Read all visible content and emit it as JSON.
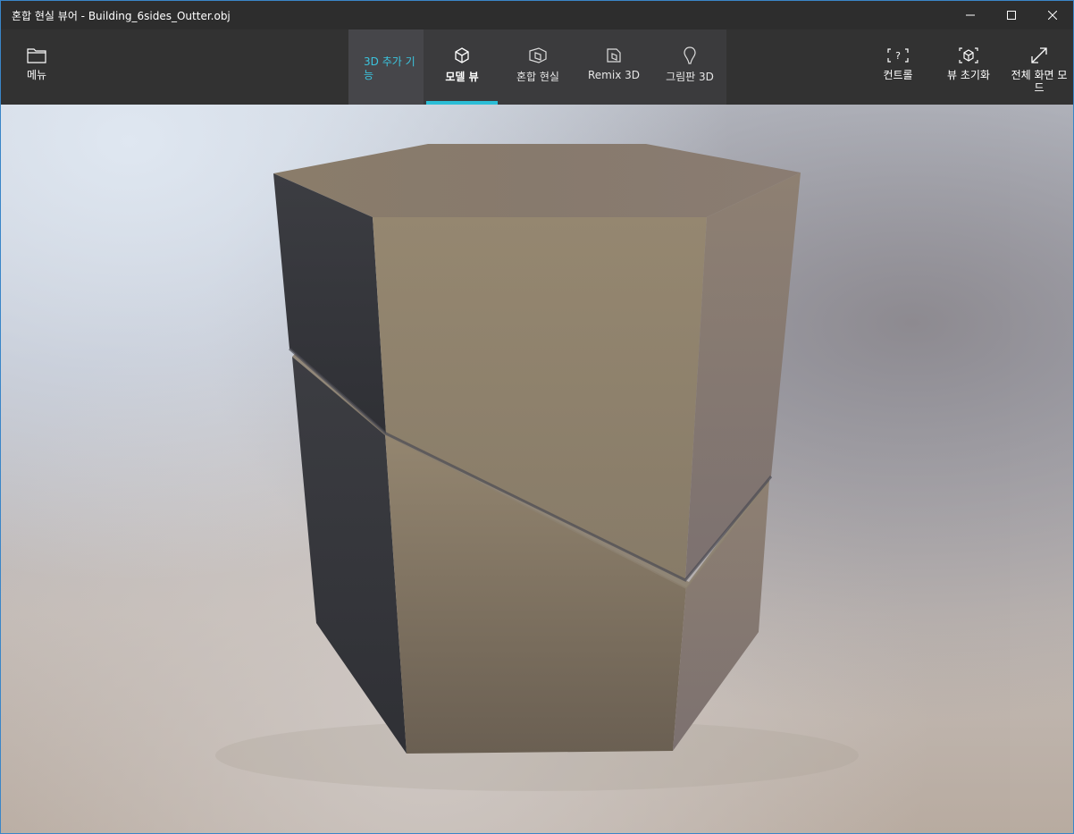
{
  "window": {
    "title": "혼합 현실 뷰어 - Building_6sides_Outter.obj",
    "buttons": {
      "minimize": "minimize-icon",
      "maximize": "maximize-icon",
      "close": "close-icon"
    }
  },
  "toolbar": {
    "menu_label": "메뉴",
    "addon_label": "3D 추가 기능",
    "tabs": [
      {
        "label": "모델 뷰",
        "icon": "cube-icon",
        "active": true
      },
      {
        "label": "혼합 현실",
        "icon": "mixed-reality-icon",
        "active": false
      },
      {
        "label": "Remix 3D",
        "icon": "remix-3d-icon",
        "active": false
      },
      {
        "label": "그림판 3D",
        "icon": "paint-3d-icon",
        "active": false
      }
    ],
    "right": [
      {
        "label": "컨트롤",
        "icon": "controls-help-icon"
      },
      {
        "label": "뷰 초기화",
        "icon": "reset-view-icon"
      },
      {
        "label": "전체 화면 모드",
        "icon": "fullscreen-icon"
      }
    ]
  },
  "colors": {
    "accent": "#2bbdd6",
    "addon_text": "#3bc4de",
    "titlebar_bg": "#2d2d2d",
    "toolbar_bg": "#323232"
  }
}
